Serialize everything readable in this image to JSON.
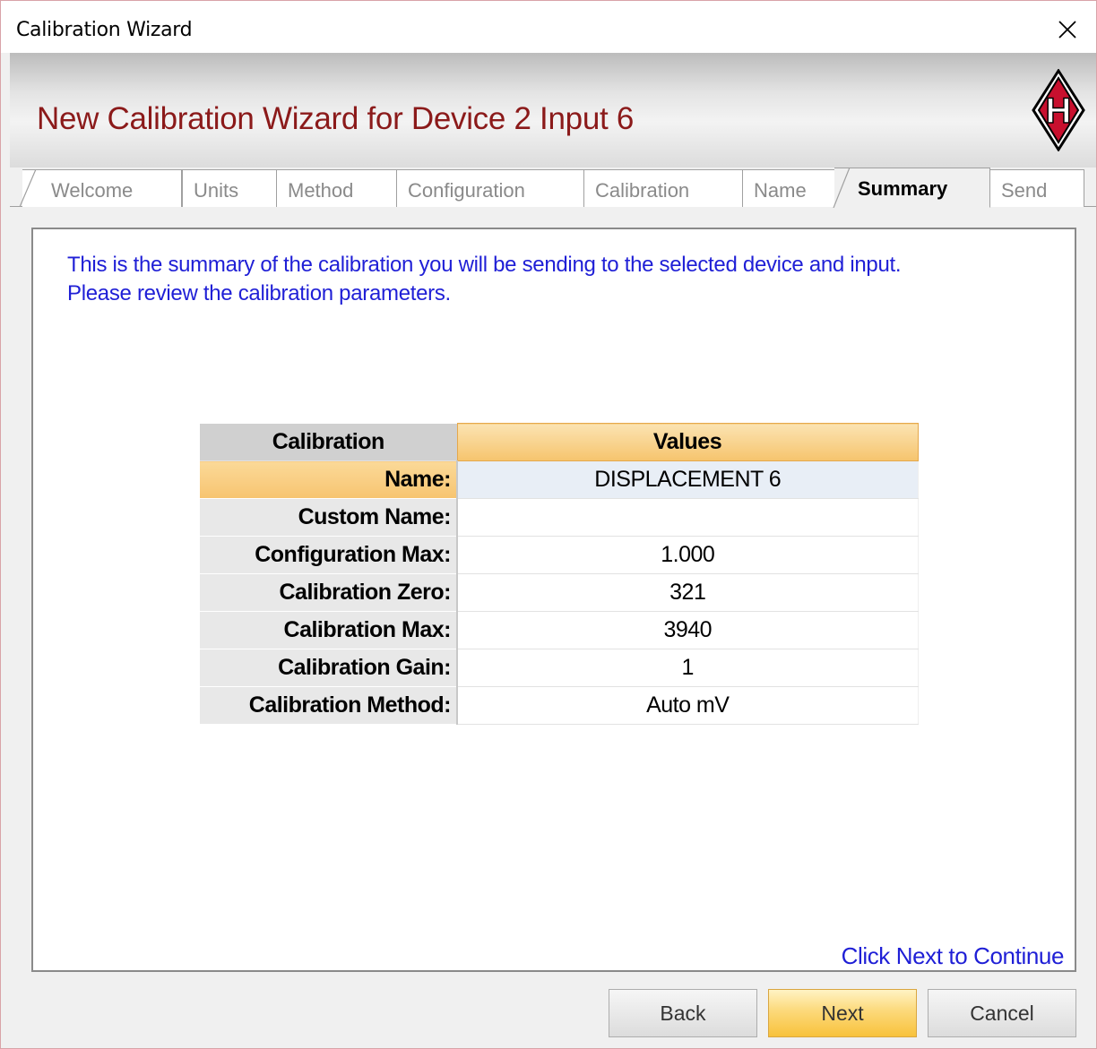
{
  "window": {
    "title": "Calibration Wizard"
  },
  "banner": {
    "heading": "New Calibration Wizard for Device 2 Input 6",
    "logo_letter": "H"
  },
  "tabs": [
    {
      "label": "Welcome"
    },
    {
      "label": "Units"
    },
    {
      "label": "Method"
    },
    {
      "label": "Configuration"
    },
    {
      "label": "Calibration"
    },
    {
      "label": "Name"
    },
    {
      "label": "Summary"
    },
    {
      "label": "Send"
    }
  ],
  "active_tab": "Summary",
  "panel": {
    "intro_line1": "This is the summary of the calibration you will be sending to the selected device and input.",
    "intro_line2": "Please review the calibration parameters.",
    "continue_text": "Click Next to Continue"
  },
  "summary_table": {
    "headers": {
      "calibration": "Calibration",
      "values": "Values"
    },
    "rows": [
      {
        "label": "Name:",
        "value": "DISPLACEMENT 6"
      },
      {
        "label": "Custom Name:",
        "value": ""
      },
      {
        "label": "Configuration Max:",
        "value": "1.000"
      },
      {
        "label": "Calibration Zero:",
        "value": "321"
      },
      {
        "label": "Calibration Max:",
        "value": "3940"
      },
      {
        "label": "Calibration Gain:",
        "value": "1"
      },
      {
        "label": "Calibration Method:",
        "value": "Auto mV"
      }
    ]
  },
  "buttons": {
    "back": "Back",
    "next": "Next",
    "cancel": "Cancel"
  },
  "colors": {
    "heading": "#8b1a1a",
    "intro_text": "#1f1fd6",
    "accent_orange": "#f6c46d",
    "logo_red": "#c8102e"
  }
}
